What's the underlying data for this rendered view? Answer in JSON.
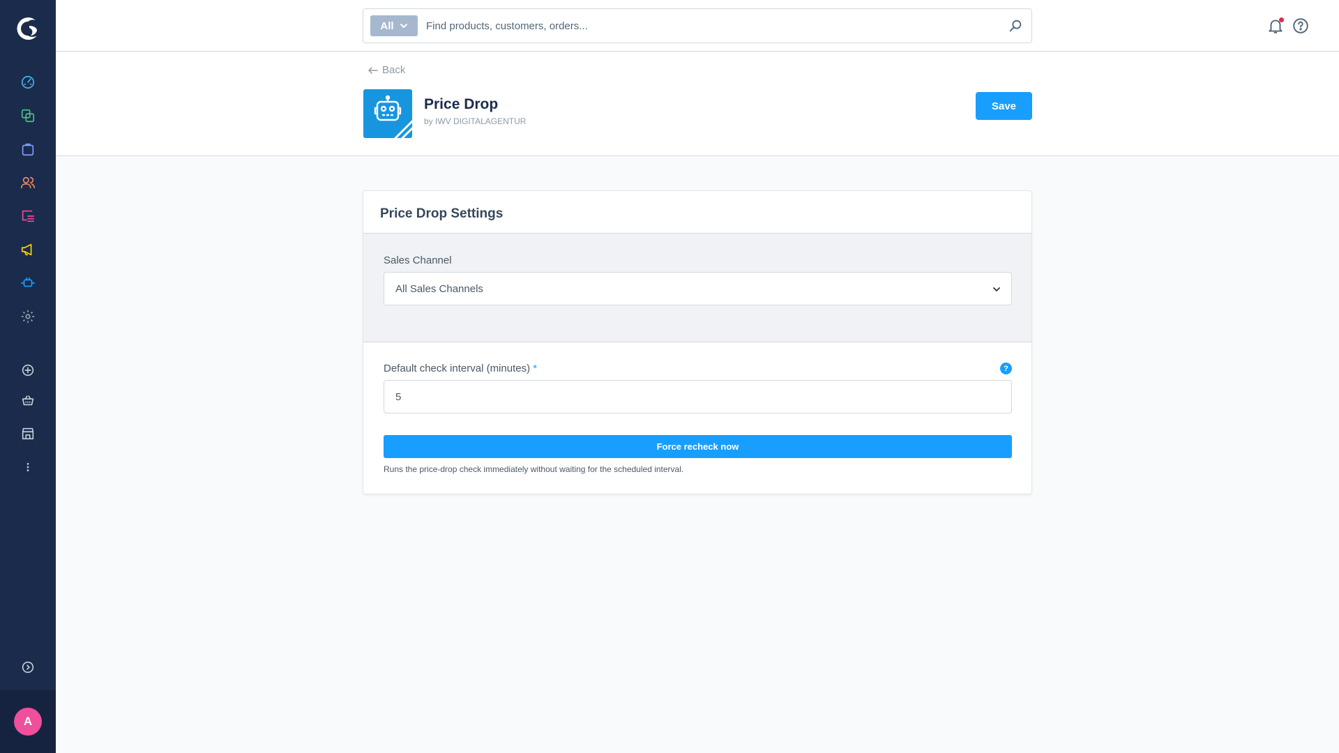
{
  "colors": {
    "sidebar_bg": "#1b2b4b",
    "accent": "#189eff",
    "avatar": "#ef4f9b",
    "notification_dot": "#de294c"
  },
  "sidebar": {
    "nav": [
      {
        "name": "dashboard",
        "icon": "gauge-icon",
        "color": "#45b5f4"
      },
      {
        "name": "catalogues",
        "icon": "layers-icon",
        "color": "#49c18d"
      },
      {
        "name": "orders",
        "icon": "shopping-bag-icon",
        "color": "#7c9fff"
      },
      {
        "name": "customers",
        "icon": "users-icon",
        "color": "#f88962"
      },
      {
        "name": "content",
        "icon": "content-list-icon",
        "color": "#ef4f9b"
      },
      {
        "name": "marketing",
        "icon": "megaphone-icon",
        "color": "#ffd700"
      },
      {
        "name": "extensions",
        "icon": "plug-icon",
        "color": "#189eff"
      },
      {
        "name": "settings",
        "icon": "gear-icon",
        "color": "#9aa8b5"
      }
    ],
    "secondary": [
      {
        "name": "add",
        "icon": "plus-circle-icon"
      },
      {
        "name": "storefront",
        "icon": "basket-icon"
      },
      {
        "name": "shop",
        "icon": "store-icon"
      },
      {
        "name": "more",
        "icon": "more-vertical-icon"
      }
    ],
    "collapse_icon": "chevron-circle-right-icon",
    "avatar_initial": "A"
  },
  "topbar": {
    "search_type": "All",
    "search_placeholder": "Find products, customers, orders...",
    "icons": [
      "bell-icon",
      "help-circle-icon"
    ]
  },
  "header": {
    "back_label": "Back",
    "app_title": "Price Drop",
    "app_author": "by IWV DIGITALAGENTUR",
    "save_label": "Save"
  },
  "card": {
    "title": "Price Drop Settings",
    "sales_channel_label": "Sales Channel",
    "sales_channel_value": "All Sales Channels",
    "interval_label": "Default check interval (minutes)",
    "interval_required": "*",
    "interval_value": "5",
    "help_glyph": "?",
    "recheck_label": "Force recheck now",
    "recheck_help": "Runs the price-drop check immediately without waiting for the scheduled interval."
  }
}
